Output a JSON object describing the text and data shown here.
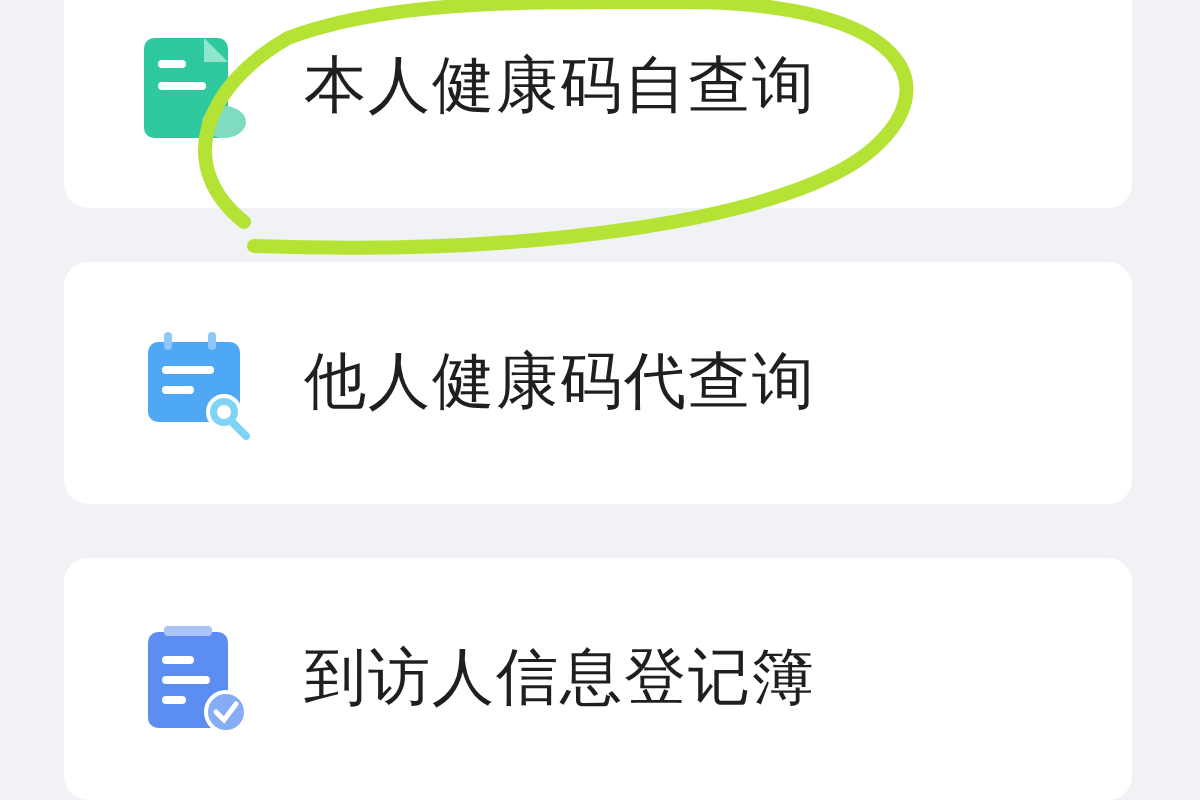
{
  "items": [
    {
      "label": "本人健康码自查询",
      "kind": "self",
      "highlighted": true
    },
    {
      "label": "他人健康码代查询",
      "kind": "proxy",
      "highlighted": false
    },
    {
      "label": "到访人信息登记簿",
      "kind": "register",
      "highlighted": false
    }
  ]
}
